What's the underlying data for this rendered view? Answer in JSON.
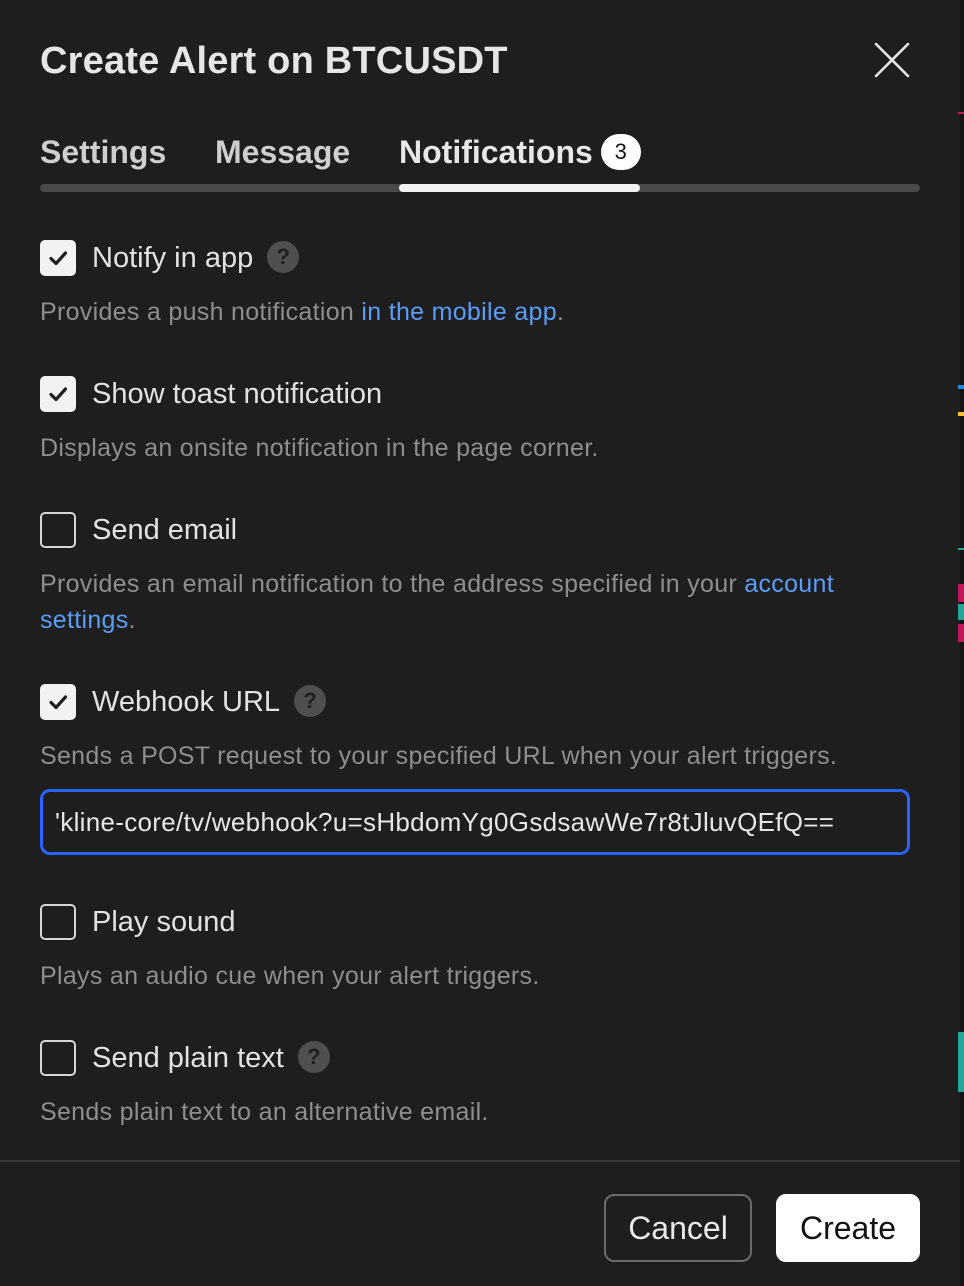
{
  "dialog": {
    "title": "Create Alert on BTCUSDT",
    "close_icon": "close-icon"
  },
  "tabs": [
    {
      "label": "Settings",
      "active": false
    },
    {
      "label": "Message",
      "active": false
    },
    {
      "label": "Notifications",
      "active": true,
      "badge": "3"
    }
  ],
  "options": {
    "notify_in_app": {
      "label": "Notify in app",
      "checked": true,
      "has_help": true,
      "desc_prefix": "Provides a push notification ",
      "desc_link": "in the mobile app",
      "desc_suffix": "."
    },
    "show_toast": {
      "label": "Show toast notification",
      "checked": true,
      "desc": "Displays an onsite notification in the page corner."
    },
    "send_email": {
      "label": "Send email",
      "checked": false,
      "desc_prefix": "Provides an email notification to the address specified in your ",
      "desc_link": "account settings",
      "desc_suffix": "."
    },
    "webhook": {
      "label": "Webhook URL",
      "checked": true,
      "has_help": true,
      "desc": "Sends a POST request to your specified URL when your alert triggers.",
      "url_value": "'kline-core/tv/webhook?u=sHbdomYg0GsdsawWe7r8tJluvQEfQ=="
    },
    "play_sound": {
      "label": "Play sound",
      "checked": false,
      "desc": "Plays an audio cue when your alert triggers."
    },
    "send_plain_text": {
      "label": "Send plain text",
      "checked": false,
      "has_help": true,
      "desc": "Sends plain text to an alternative email."
    }
  },
  "help_glyph": "?",
  "footer": {
    "cancel_label": "Cancel",
    "create_label": "Create"
  },
  "colors": {
    "background": "#1e1e1e",
    "accent_blue": "#2962ff",
    "link_blue": "#5b9cf6"
  }
}
